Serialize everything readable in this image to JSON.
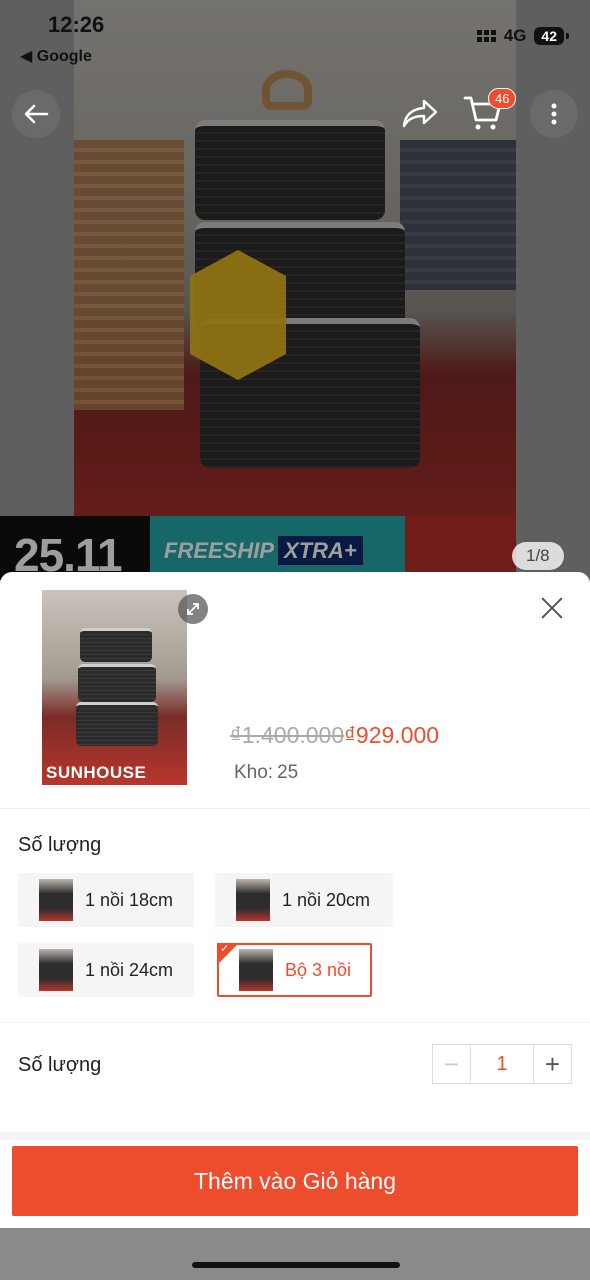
{
  "status_bar": {
    "time": "12:26",
    "back_app": "◀ Google",
    "network": "4G",
    "battery": "42"
  },
  "top_nav": {
    "cart_count": "46"
  },
  "gallery": {
    "counter": "1/8",
    "promo_date": "25.11",
    "promo_freeship": "FREESHIP",
    "promo_xtra": "XTRA+",
    "brand": "SUNHOUSE"
  },
  "sheet": {
    "price_original": "₫1.400.000",
    "price_sale": "₫929.000",
    "stock_label": "Kho:",
    "stock_value": "25",
    "variants_title": "Số lượng",
    "variants": [
      {
        "label": "1 nồi 18cm",
        "selected": false
      },
      {
        "label": "1 nồi 20cm",
        "selected": false
      },
      {
        "label": "1 nồi 24cm",
        "selected": false
      },
      {
        "label": "Bộ 3 nồi",
        "selected": true
      }
    ],
    "quantity_title": "Số lượng",
    "quantity_minus": "−",
    "quantity_value": "1",
    "quantity_plus": "+",
    "add_to_cart": "Thêm vào Giỏ hàng"
  },
  "colors": {
    "accent": "#ee4d2d",
    "muted_text": "#666666",
    "divider": "#eeeeee"
  }
}
